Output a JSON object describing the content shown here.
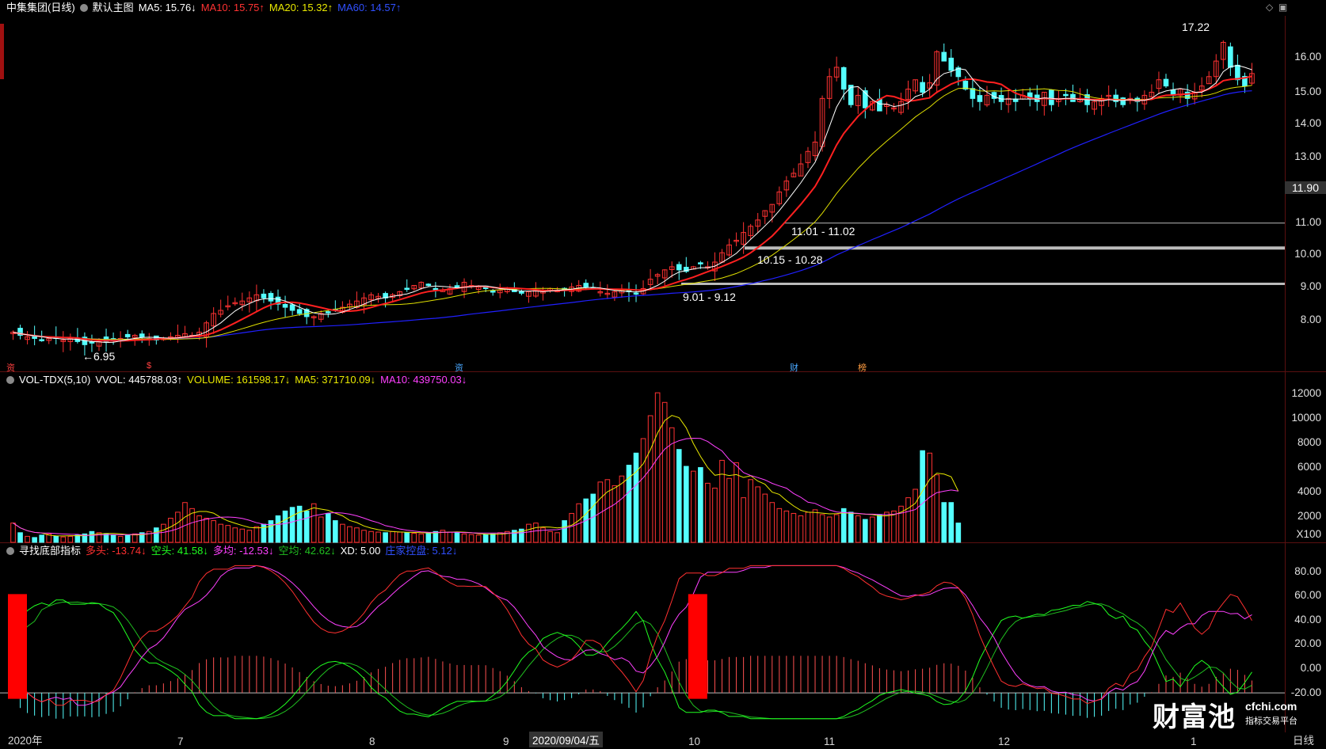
{
  "main_header": {
    "title": "中集集团(日线)",
    "template": "默认主图",
    "ma5": "MA5: 15.76↓",
    "ma10": "MA10: 15.75↑",
    "ma20": "MA20: 15.32↑",
    "ma60": "MA60: 14.57↑"
  },
  "vol_header": {
    "title": "VOL-TDX(5,10)",
    "vvol": "VVOL: 445788.03↑",
    "volume": "VOLUME: 161598.17↓",
    "ma5": "MA5: 371710.09↓",
    "ma10": "MA10: 439750.03↓"
  },
  "ind_header": {
    "title": "寻找底部指标",
    "duotou": "多头: -13.74↓",
    "kongtou": "空头: 41.58↓",
    "duojun": "多均: -12.53↓",
    "kongjun": "空均: 42.62↓",
    "xd": "XD: 5.00",
    "zhuangjia": "庄家控盘: 5.12↓"
  },
  "price_axis": [
    "16.00",
    "15.00",
    "14.00",
    "13.00",
    "11.00",
    "10.00",
    "9.00",
    "8.00"
  ],
  "current_price": "11.90",
  "vol_axis": [
    "12000",
    "10000",
    "8000",
    "6000",
    "4000",
    "2000"
  ],
  "vol_unit": "X100",
  "ind_axis": [
    "80.00",
    "60.00",
    "40.00",
    "20.00",
    "0.00",
    "-20.00"
  ],
  "month_labels": [
    "2020年",
    "7",
    "8",
    "9",
    "2020/09/04/五",
    "10",
    "11",
    "12",
    "1"
  ],
  "period_label": "日线",
  "annotations": {
    "high": "17.22",
    "low": "←6.95",
    "zone1": "11.01 - 11.02",
    "zone2": "10.15 - 10.28",
    "zone3": "9.01 - 9.12"
  },
  "markers": [
    "资",
    "$",
    "资",
    "财",
    "榜"
  ],
  "watermark": {
    "name": "财富池",
    "site": "cfchi.com",
    "slogan": "指标交易平台"
  },
  "colors": {
    "up": "#ff3232",
    "down": "#54ffff",
    "ma5": "#ffffff",
    "ma10": "#ff2020",
    "ma20": "#e0e000",
    "ma60": "#2020ff",
    "duotou": "#ff3030",
    "kongtou": "#20ff20",
    "duojun": "#ff40ff",
    "kongjun": "#20c020"
  },
  "chart_data": {
    "type": "candlestick",
    "closes": [
      7.5,
      7.4,
      7.35,
      7.3,
      7.25,
      7.3,
      7.3,
      7.25,
      7.3,
      7.2,
      7.1,
      7.15,
      7.2,
      7.2,
      7.25,
      7.3,
      7.35,
      7.4,
      7.35,
      7.3,
      7.25,
      7.3,
      7.35,
      7.4,
      7.45,
      7.4,
      7.5,
      7.8,
      8.1,
      8.2,
      8.35,
      8.45,
      8.5,
      8.6,
      8.7,
      8.6,
      8.5,
      8.4,
      8.3,
      8.2,
      8.1,
      8.0,
      8.0,
      8.1,
      8.15,
      8.2,
      8.3,
      8.4,
      8.5,
      8.6,
      8.7,
      8.65,
      8.6,
      8.7,
      8.8,
      8.9,
      9.0,
      9.1,
      9.0,
      8.9,
      8.85,
      8.9,
      8.95,
      9.1,
      9.0,
      8.95,
      8.9,
      8.8,
      8.85,
      8.9,
      8.8,
      8.75,
      8.8,
      8.85,
      8.8,
      8.9,
      8.85,
      8.9,
      8.95,
      9.0,
      8.95,
      8.9,
      8.8,
      8.75,
      8.8,
      8.85,
      8.8,
      8.75,
      8.9,
      9.2,
      9.35,
      9.5,
      9.6,
      9.5,
      9.45,
      9.6,
      9.7,
      9.6,
      9.75,
      10.05,
      10.3,
      10.45,
      10.7,
      10.9,
      11.1,
      11.4,
      11.6,
      12.0,
      12.35,
      12.6,
      12.9,
      13.3,
      13.6,
      15.0,
      15.7,
      16.0,
      15.3,
      14.8,
      15.1,
      14.7,
      14.9,
      14.6,
      14.8,
      14.7,
      14.9,
      15.3,
      15.6,
      15.2,
      15.5,
      16.5,
      16.2,
      15.9,
      15.7,
      15.3,
      15.0,
      14.9,
      15.1,
      15.0,
      14.9,
      15.0,
      14.9,
      15.1,
      15.0,
      14.9,
      15.2,
      14.8,
      15.0,
      15.1,
      14.9,
      15.0,
      14.8,
      14.9,
      15.0,
      15.1,
      14.9,
      14.8,
      15.0,
      14.9,
      15.1,
      15.2,
      15.6,
      15.4,
      15.1,
      15.3,
      15.0,
      15.2,
      15.4,
      15.7,
      16.2,
      16.8,
      16.0,
      15.6,
      15.4,
      15.8
    ],
    "volumes": [
      1600,
      800,
      500,
      400,
      600,
      700,
      500,
      450,
      500,
      600,
      700,
      900,
      800,
      700,
      600,
      500,
      600,
      700,
      800,
      900,
      1200,
      1500,
      2000,
      2500,
      3300,
      2800,
      2200,
      2000,
      1800,
      1500,
      1400,
      1200,
      1100,
      1000,
      1300,
      1500,
      1800,
      2200,
      2600,
      2900,
      3000,
      2600,
      3200,
      2100,
      2400,
      1800,
      1500,
      1300,
      1200,
      1000,
      900,
      850,
      800,
      900,
      850,
      800,
      750,
      700,
      800,
      900,
      1000,
      850,
      800,
      700,
      650,
      600,
      650,
      700,
      800,
      900,
      1000,
      1100,
      1500,
      1600,
      1200,
      900,
      800,
      1800,
      2400,
      3200,
      3600,
      4000,
      5000,
      5200,
      4700,
      5500,
      6400,
      7400,
      8600,
      10500,
      12400,
      11600,
      9500,
      7700,
      6300,
      5900,
      6200,
      4900,
      4500,
      6800,
      5300,
      6600,
      3700,
      5200,
      4600,
      4000,
      3300,
      2800,
      2600,
      2400,
      2200,
      2500,
      2700,
      2300,
      2100,
      2300,
      2800,
      2500,
      2200,
      1900,
      2100,
      2300,
      2500,
      2600,
      3000,
      3700,
      4400,
      7600,
      7400,
      5600,
      3300,
      3300,
      1600
    ]
  }
}
